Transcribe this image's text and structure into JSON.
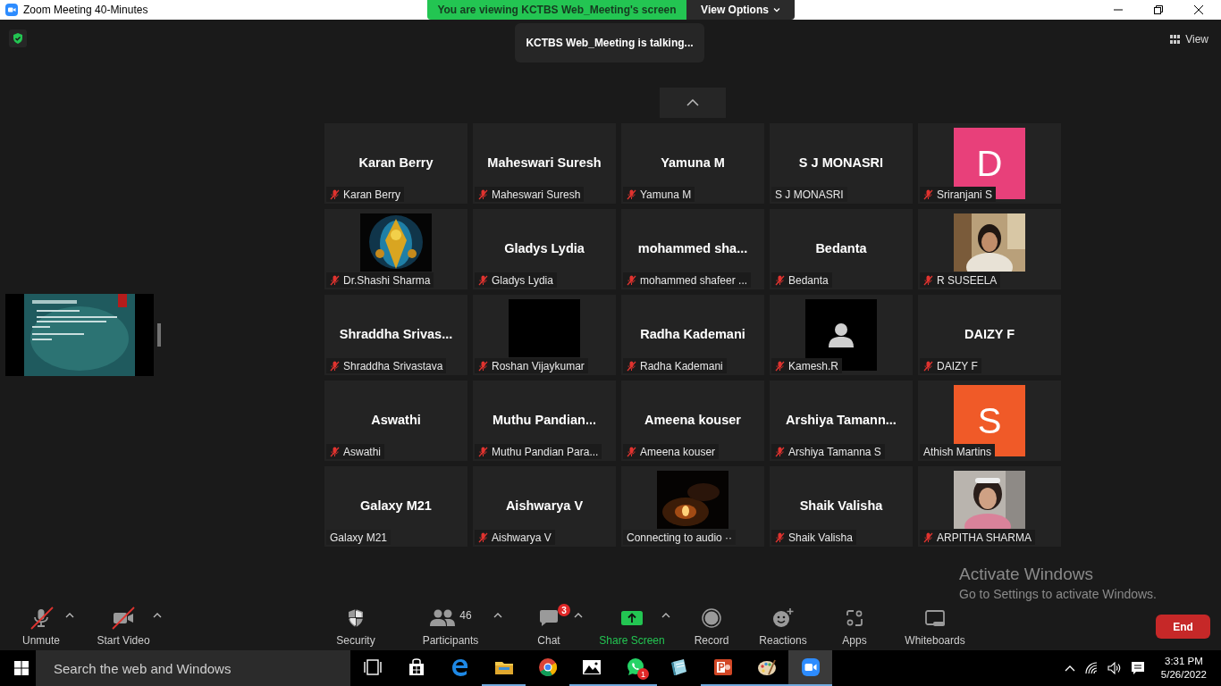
{
  "window": {
    "title": "Zoom Meeting 40-Minutes"
  },
  "share_banner": {
    "text": "You are viewing KCTBS Web_Meeting's screen",
    "view_options": "View Options"
  },
  "talking_toast": "KCTBS Web_Meeting is talking...",
  "view_button": "View",
  "tiles": [
    {
      "kind": "name",
      "display": "Karan Berry",
      "label": "Karan Berry",
      "muted": true
    },
    {
      "kind": "name",
      "display": "Maheswari Suresh",
      "label": "Maheswari Suresh",
      "muted": true
    },
    {
      "kind": "name",
      "display": "Yamuna M",
      "label": "Yamuna M",
      "muted": true
    },
    {
      "kind": "name",
      "display": "S J MONASRI",
      "label": "S J MONASRI",
      "muted": false
    },
    {
      "kind": "letter",
      "display": "D",
      "color": "#e8407a",
      "label": "Sriranjani S",
      "muted": true
    },
    {
      "kind": "picture",
      "label": "Dr.Shashi Sharma",
      "muted": true
    },
    {
      "kind": "name",
      "display": "Gladys Lydia",
      "label": "Gladys Lydia",
      "muted": true
    },
    {
      "kind": "name",
      "display": "mohammed  sha...",
      "label": "mohammed shafeer ...",
      "muted": true
    },
    {
      "kind": "name",
      "display": "Bedanta",
      "label": "Bedanta",
      "muted": true
    },
    {
      "kind": "picture",
      "label": "R SUSEELA",
      "muted": true
    },
    {
      "kind": "name",
      "display": "Shraddha  Srivas...",
      "label": "Shraddha Srivastava",
      "muted": true
    },
    {
      "kind": "blank",
      "label": "Roshan Vijaykumar",
      "muted": true
    },
    {
      "kind": "name",
      "display": "Radha Kademani",
      "label": "Radha Kademani",
      "muted": true
    },
    {
      "kind": "avatar",
      "label": "Kamesh.R",
      "muted": true
    },
    {
      "kind": "name",
      "display": "DAIZY F",
      "label": "DAIZY F",
      "muted": true
    },
    {
      "kind": "name",
      "display": "Aswathi",
      "label": "Aswathi",
      "muted": true
    },
    {
      "kind": "name",
      "display": "Muthu  Pandian...",
      "label": "Muthu Pandian Para...",
      "muted": true
    },
    {
      "kind": "name",
      "display": "Ameena kouser",
      "label": "Ameena kouser",
      "muted": true
    },
    {
      "kind": "name",
      "display": "Arshiya  Tamann...",
      "label": "Arshiya Tamanna S",
      "muted": true
    },
    {
      "kind": "letter",
      "display": "S",
      "color": "#f05a28",
      "label": "Athish Martins",
      "muted": false
    },
    {
      "kind": "name",
      "display": "Galaxy M21",
      "label": "Galaxy M21",
      "muted": false
    },
    {
      "kind": "name",
      "display": "Aishwarya V",
      "label": "Aishwarya V",
      "muted": true
    },
    {
      "kind": "picture",
      "label": "Connecting to audio ··",
      "muted": false
    },
    {
      "kind": "name",
      "display": "Shaik Valisha",
      "label": "Shaik Valisha",
      "muted": true
    },
    {
      "kind": "picture",
      "label": "ARPITHA SHARMA",
      "muted": true
    }
  ],
  "toolbar": {
    "items": [
      {
        "kind": "audio",
        "label": "Unmute",
        "off": true,
        "active": false,
        "menu": true
      },
      {
        "kind": "video",
        "label": "Start Video",
        "off": true,
        "active": false,
        "menu": true
      },
      {
        "kind": "security",
        "label": "Security",
        "off": false,
        "active": false,
        "menu": false
      },
      {
        "kind": "participants",
        "label": "Participants",
        "count": "46",
        "off": false,
        "active": false,
        "menu": true
      },
      {
        "kind": "chat",
        "label": "Chat",
        "badge": "3",
        "off": false,
        "active": false,
        "menu": true
      },
      {
        "kind": "share",
        "label": "Share Screen",
        "off": false,
        "active": true,
        "menu": true
      },
      {
        "kind": "record",
        "label": "Record",
        "off": false,
        "active": false,
        "menu": false
      },
      {
        "kind": "reactions",
        "label": "Reactions",
        "off": false,
        "active": false,
        "menu": false
      },
      {
        "kind": "apps",
        "label": "Apps",
        "off": false,
        "active": false,
        "menu": false
      },
      {
        "kind": "whiteboards",
        "label": "Whiteboards",
        "off": false,
        "active": false,
        "menu": false
      }
    ],
    "end": "End"
  },
  "activation": {
    "title": "Activate Windows",
    "text": "Go to Settings to activate Windows."
  },
  "taskbar": {
    "search_placeholder": "Search the web and Windows",
    "apps": [
      {
        "kind": "taskview",
        "running": false,
        "selected": false
      },
      {
        "kind": "store",
        "running": false,
        "selected": false
      },
      {
        "kind": "edge",
        "running": false,
        "selected": false
      },
      {
        "kind": "explorer",
        "running": true,
        "selected": false
      },
      {
        "kind": "chrome",
        "running": false,
        "selected": false
      },
      {
        "kind": "photos",
        "running": true,
        "selected": false
      },
      {
        "kind": "whatsapp",
        "running": true,
        "selected": false,
        "badge": "1"
      },
      {
        "kind": "notebook",
        "running": false,
        "selected": false
      },
      {
        "kind": "powerpoint",
        "running": true,
        "selected": false
      },
      {
        "kind": "paint",
        "running": true,
        "selected": false
      },
      {
        "kind": "zoom",
        "running": true,
        "selected": true
      }
    ],
    "time": "3:31 PM",
    "date": "5/26/2022"
  }
}
